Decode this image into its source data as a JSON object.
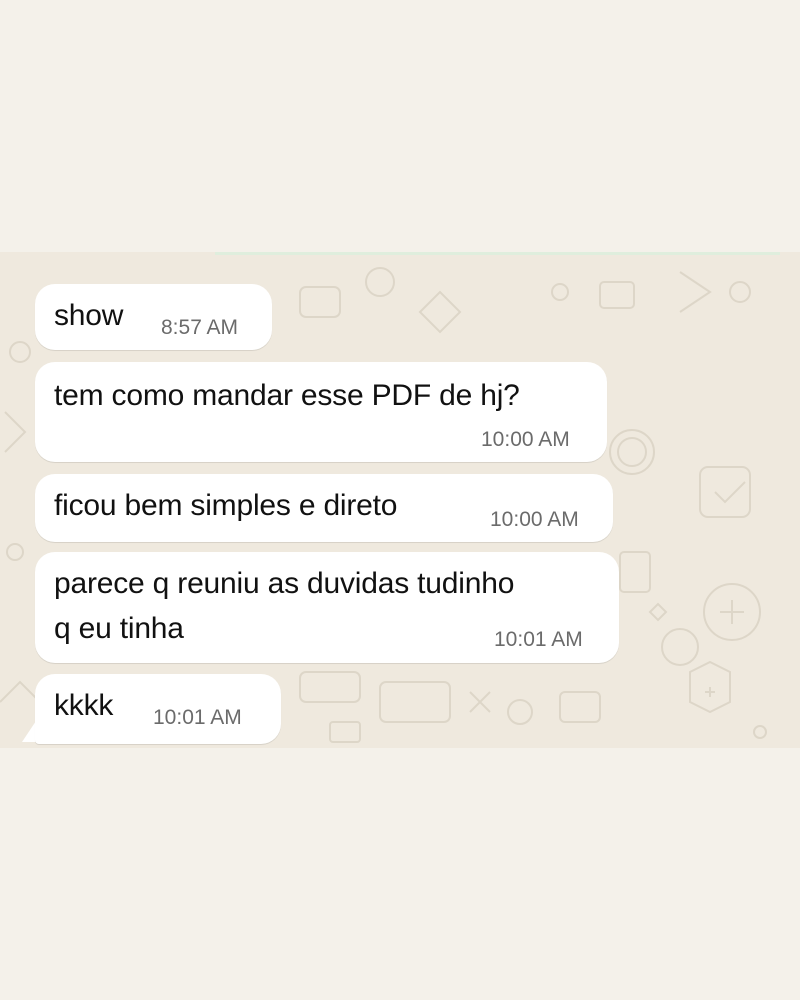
{
  "messages": [
    {
      "text": "show",
      "time": "8:57 AM"
    },
    {
      "text": "tem como mandar esse PDF de hj?",
      "time": "10:00 AM"
    },
    {
      "text": "ficou bem simples e direto",
      "time": "10:00 AM"
    },
    {
      "text_lines": [
        "parece q reuniu as duvidas tudinho",
        "q eu tinha"
      ],
      "time": "10:01 AM"
    },
    {
      "text": "kkkk",
      "time": "10:01 AM"
    }
  ],
  "colors": {
    "page_background": "#f4f1ea",
    "chat_wallpaper": "#efe9de",
    "bubble": "#ffffff",
    "text": "#111111",
    "timestamp": "#6b6b6b"
  }
}
